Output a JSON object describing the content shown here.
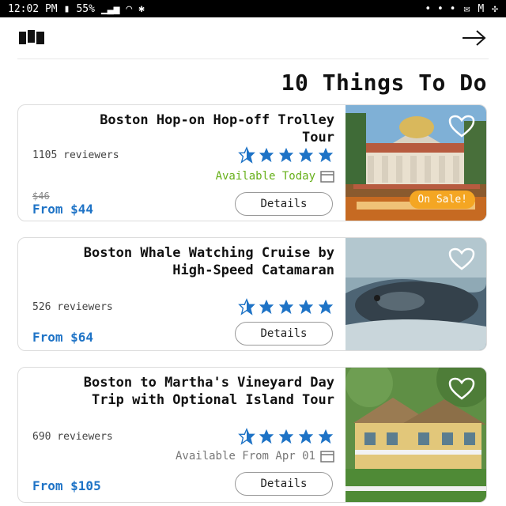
{
  "status_bar": {
    "time": "12:02 PM",
    "battery": "55%",
    "notification_icons": [
      "m-icon",
      "pinwheel-icon",
      "mail-icon"
    ]
  },
  "header": {
    "map_icon": "map-icon",
    "back_icon": "arrow-right-icon"
  },
  "title": "10 Things To Do",
  "colors": {
    "price_blue": "#1e73c6",
    "star_blue": "#1e73c6",
    "available_green": "#67b01a",
    "sale_orange": "#f4a623"
  },
  "cards": [
    {
      "title": "Boston Hop-on Hop-off Trolley Tour",
      "rating": 4.5,
      "reviews": "1105 reviewers",
      "availability": "Available Today",
      "old_price": "$46",
      "price": "From $44",
      "button": "Details",
      "badge": "On Sale!"
    },
    {
      "title": "Boston Whale Watching Cruise by High-Speed Catamaran",
      "rating": 4.5,
      "reviews": "526 reviewers",
      "price": "From $64",
      "button": "Details"
    },
    {
      "title": "Boston to Martha's Vineyard Day Trip with Optional Island Tour",
      "rating": 4.5,
      "reviews": "690 reviewers",
      "availability": "Available From Apr 01",
      "price": "From $105",
      "button": "Details"
    }
  ]
}
